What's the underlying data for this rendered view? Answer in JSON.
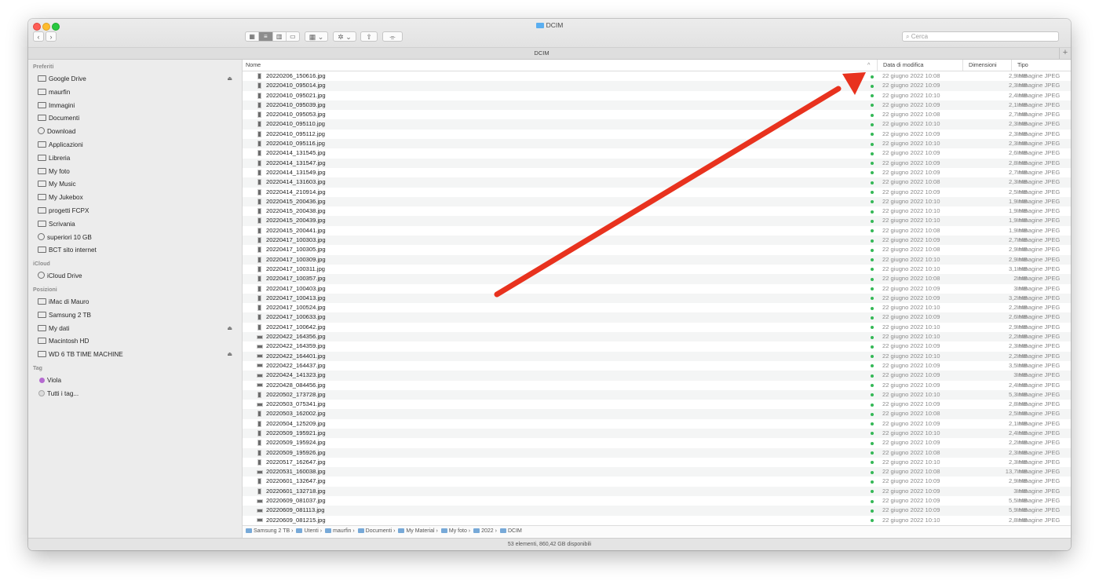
{
  "window": {
    "title": "DCIM",
    "path_title": "DCIM",
    "search_placeholder": "Cerca"
  },
  "toolbar": {
    "back": "‹",
    "forward": "›",
    "plus": "+"
  },
  "sidebar": {
    "sections": [
      {
        "title": "Preferiti",
        "items": [
          {
            "label": "Google Drive",
            "icon": "drive-icon",
            "eject": true
          },
          {
            "label": "maurfin",
            "icon": "home-icon"
          },
          {
            "label": "Immagini",
            "icon": "camera-icon"
          },
          {
            "label": "Documenti",
            "icon": "document-icon"
          },
          {
            "label": "Download",
            "icon": "download-icon"
          },
          {
            "label": "Applicazioni",
            "icon": "applications-icon"
          },
          {
            "label": "Libreria",
            "icon": "folder-icon"
          },
          {
            "label": "My foto",
            "icon": "folder-icon"
          },
          {
            "label": "My Music",
            "icon": "folder-icon"
          },
          {
            "label": "My Jukebox",
            "icon": "folder-icon"
          },
          {
            "label": "progetti FCPX",
            "icon": "folder-icon"
          },
          {
            "label": "Scrivania",
            "icon": "folder-icon"
          },
          {
            "label": "superiori 10 GB",
            "icon": "gear-icon"
          },
          {
            "label": "BCT sito internet",
            "icon": "folder-icon"
          }
        ]
      },
      {
        "title": "iCloud",
        "items": [
          {
            "label": "iCloud Drive",
            "icon": "cloud-icon"
          }
        ]
      },
      {
        "title": "Posizioni",
        "items": [
          {
            "label": "iMac di Mauro",
            "icon": "computer-icon"
          },
          {
            "label": "Samsung 2 TB",
            "icon": "disk-icon"
          },
          {
            "label": "My dati",
            "icon": "disk-icon",
            "eject": true
          },
          {
            "label": "Macintosh HD",
            "icon": "disk-icon"
          },
          {
            "label": "WD 6 TB TIME MACHINE",
            "icon": "disk-icon",
            "eject": true
          }
        ]
      },
      {
        "title": "Tag",
        "items": [
          {
            "label": "Viola",
            "icon": "tag-purple-icon"
          },
          {
            "label": "Tutti i tag...",
            "icon": "tag-all-icon"
          }
        ]
      }
    ]
  },
  "columns": {
    "name": "Nome",
    "date": "Data di modifica",
    "size": "Dimensioni",
    "kind": "Tipo",
    "sort_indicator": "^"
  },
  "files": [
    {
      "name": "20220206_150616.jpg",
      "date": "22 giugno 2022 10:08",
      "size": "2,9 MB",
      "kind": "Immagine JPEG"
    },
    {
      "name": "20220410_095014.jpg",
      "date": "22 giugno 2022 10:09",
      "size": "2,3 MB",
      "kind": "Immagine JPEG"
    },
    {
      "name": "20220410_095021.jpg",
      "date": "22 giugno 2022 10:10",
      "size": "2,4 MB",
      "kind": "Immagine JPEG"
    },
    {
      "name": "20220410_095039.jpg",
      "date": "22 giugno 2022 10:09",
      "size": "2,1 MB",
      "kind": "Immagine JPEG"
    },
    {
      "name": "20220410_095053.jpg",
      "date": "22 giugno 2022 10:08",
      "size": "2,7 MB",
      "kind": "Immagine JPEG"
    },
    {
      "name": "20220410_095110.jpg",
      "date": "22 giugno 2022 10:10",
      "size": "2,3 MB",
      "kind": "Immagine JPEG"
    },
    {
      "name": "20220410_095112.jpg",
      "date": "22 giugno 2022 10:09",
      "size": "2,3 MB",
      "kind": "Immagine JPEG"
    },
    {
      "name": "20220410_095116.jpg",
      "date": "22 giugno 2022 10:10",
      "size": "2,3 MB",
      "kind": "Immagine JPEG"
    },
    {
      "name": "20220414_131545.jpg",
      "date": "22 giugno 2022 10:09",
      "size": "2,6 MB",
      "kind": "Immagine JPEG"
    },
    {
      "name": "20220414_131547.jpg",
      "date": "22 giugno 2022 10:09",
      "size": "2,8 MB",
      "kind": "Immagine JPEG"
    },
    {
      "name": "20220414_131549.jpg",
      "date": "22 giugno 2022 10:09",
      "size": "2,7 MB",
      "kind": "Immagine JPEG"
    },
    {
      "name": "20220414_131603.jpg",
      "date": "22 giugno 2022 10:08",
      "size": "2,3 MB",
      "kind": "Immagine JPEG"
    },
    {
      "name": "20220414_210914.jpg",
      "date": "22 giugno 2022 10:09",
      "size": "2,5 MB",
      "kind": "Immagine JPEG"
    },
    {
      "name": "20220415_200436.jpg",
      "date": "22 giugno 2022 10:10",
      "size": "1,9 MB",
      "kind": "Immagine JPEG"
    },
    {
      "name": "20220415_200438.jpg",
      "date": "22 giugno 2022 10:10",
      "size": "1,9 MB",
      "kind": "Immagine JPEG"
    },
    {
      "name": "20220415_200439.jpg",
      "date": "22 giugno 2022 10:10",
      "size": "1,9 MB",
      "kind": "Immagine JPEG"
    },
    {
      "name": "20220415_200441.jpg",
      "date": "22 giugno 2022 10:08",
      "size": "1,9 MB",
      "kind": "Immagine JPEG"
    },
    {
      "name": "20220417_100303.jpg",
      "date": "22 giugno 2022 10:09",
      "size": "2,7 MB",
      "kind": "Immagine JPEG"
    },
    {
      "name": "20220417_100305.jpg",
      "date": "22 giugno 2022 10:08",
      "size": "2,9 MB",
      "kind": "Immagine JPEG"
    },
    {
      "name": "20220417_100309.jpg",
      "date": "22 giugno 2022 10:10",
      "size": "2,9 MB",
      "kind": "Immagine JPEG"
    },
    {
      "name": "20220417_100311.jpg",
      "date": "22 giugno 2022 10:10",
      "size": "3,1 MB",
      "kind": "Immagine JPEG"
    },
    {
      "name": "20220417_100357.jpg",
      "date": "22 giugno 2022 10:08",
      "size": "2 MB",
      "kind": "Immagine JPEG"
    },
    {
      "name": "20220417_100403.jpg",
      "date": "22 giugno 2022 10:09",
      "size": "3 MB",
      "kind": "Immagine JPEG"
    },
    {
      "name": "20220417_100413.jpg",
      "date": "22 giugno 2022 10:09",
      "size": "3,2 MB",
      "kind": "Immagine JPEG"
    },
    {
      "name": "20220417_100524.jpg",
      "date": "22 giugno 2022 10:10",
      "size": "2,2 MB",
      "kind": "Immagine JPEG"
    },
    {
      "name": "20220417_100633.jpg",
      "date": "22 giugno 2022 10:09",
      "size": "2,6 MB",
      "kind": "Immagine JPEG"
    },
    {
      "name": "20220417_100642.jpg",
      "date": "22 giugno 2022 10:10",
      "size": "2,9 MB",
      "kind": "Immagine JPEG"
    },
    {
      "name": "20220422_164356.jpg",
      "date": "22 giugno 2022 10:10",
      "size": "2,2 MB",
      "kind": "Immagine JPEG"
    },
    {
      "name": "20220422_164359.jpg",
      "date": "22 giugno 2022 10:09",
      "size": "2,3 MB",
      "kind": "Immagine JPEG"
    },
    {
      "name": "20220422_164401.jpg",
      "date": "22 giugno 2022 10:10",
      "size": "2,2 MB",
      "kind": "Immagine JPEG"
    },
    {
      "name": "20220422_164437.jpg",
      "date": "22 giugno 2022 10:09",
      "size": "3,5 MB",
      "kind": "Immagine JPEG"
    },
    {
      "name": "20220424_141323.jpg",
      "date": "22 giugno 2022 10:09",
      "size": "3 MB",
      "kind": "Immagine JPEG"
    },
    {
      "name": "20220428_084456.jpg",
      "date": "22 giugno 2022 10:09",
      "size": "2,4 MB",
      "kind": "Immagine JPEG"
    },
    {
      "name": "20220502_173728.jpg",
      "date": "22 giugno 2022 10:10",
      "size": "5,3 MB",
      "kind": "Immagine JPEG"
    },
    {
      "name": "20220503_075341.jpg",
      "date": "22 giugno 2022 10:09",
      "size": "2,8 MB",
      "kind": "Immagine JPEG"
    },
    {
      "name": "20220503_162002.jpg",
      "date": "22 giugno 2022 10:08",
      "size": "2,5 MB",
      "kind": "Immagine JPEG"
    },
    {
      "name": "20220504_125209.jpg",
      "date": "22 giugno 2022 10:09",
      "size": "2,1 MB",
      "kind": "Immagine JPEG"
    },
    {
      "name": "20220509_195921.jpg",
      "date": "22 giugno 2022 10:10",
      "size": "2,4 MB",
      "kind": "Immagine JPEG"
    },
    {
      "name": "20220509_195924.jpg",
      "date": "22 giugno 2022 10:09",
      "size": "2,2 MB",
      "kind": "Immagine JPEG"
    },
    {
      "name": "20220509_195926.jpg",
      "date": "22 giugno 2022 10:08",
      "size": "2,3 MB",
      "kind": "Immagine JPEG"
    },
    {
      "name": "20220517_162647.jpg",
      "date": "22 giugno 2022 10:10",
      "size": "2,3 MB",
      "kind": "Immagine JPEG"
    },
    {
      "name": "20220531_160038.jpg",
      "date": "22 giugno 2022 10:08",
      "size": "13,7 MB",
      "kind": "Immagine JPEG"
    },
    {
      "name": "20220601_132647.jpg",
      "date": "22 giugno 2022 10:09",
      "size": "2,9 MB",
      "kind": "Immagine JPEG"
    },
    {
      "name": "20220601_132718.jpg",
      "date": "22 giugno 2022 10:09",
      "size": "3 MB",
      "kind": "Immagine JPEG"
    },
    {
      "name": "20220609_081037.jpg",
      "date": "22 giugno 2022 10:09",
      "size": "5,5 MB",
      "kind": "Immagine JPEG"
    },
    {
      "name": "20220609_081113.jpg",
      "date": "22 giugno 2022 10:09",
      "size": "5,9 MB",
      "kind": "Immagine JPEG"
    },
    {
      "name": "20220609_081215.jpg",
      "date": "22 giugno 2022 10:10",
      "size": "2,8 MB",
      "kind": "Immagine JPEG"
    }
  ],
  "breadcrumb": [
    "Samsung 2 TB",
    "Utenti",
    "maurfin",
    "Documenti",
    "My Material",
    "My foto",
    "2022",
    "DCIM"
  ],
  "status": "53 elementi, 860,42 GB disponibili",
  "annotation": {
    "arrow_color": "#e8321e"
  }
}
